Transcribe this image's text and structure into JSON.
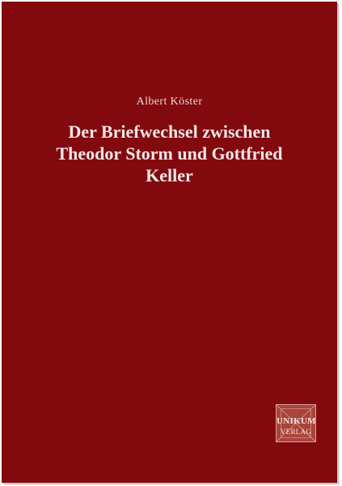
{
  "cover": {
    "background_color": "#820a0f",
    "author": "Albert Köster",
    "title_lines": [
      "Der Briefwechsel zwischen",
      "Theodor Storm und Gottfried",
      "Keller"
    ]
  },
  "publisher_logo": {
    "line1": "UNIKUM",
    "line2": "VERLAG",
    "color": "#a8443a"
  }
}
